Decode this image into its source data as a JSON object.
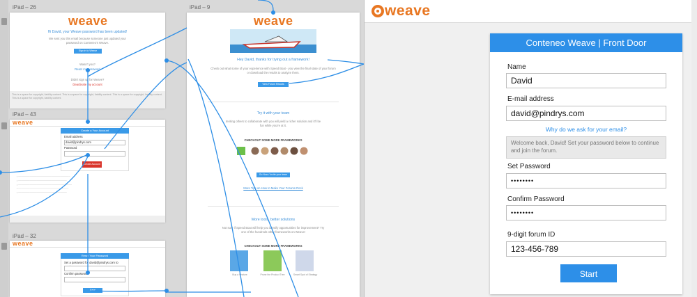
{
  "canvas": {
    "boards": [
      {
        "label": "iPad – 26"
      },
      {
        "label": "iPad – 9"
      },
      {
        "label": "iPad – 43"
      },
      {
        "label": "iPad – 32"
      }
    ],
    "board26": {
      "logo": "weave",
      "heading": "Hi David, your Weave password has been updated!",
      "body": "We sent you this email because someone just updated your password on Conteneo's Weave.",
      "button": "Sign in to Weave",
      "wasnt_you": "Wasn't you?",
      "reset": "Reset my password",
      "didnt_sign": "Didn't sign up for Weave?",
      "deactivate": "Deactivate my account",
      "footer": "This is a space for copyright, liability content. This is a space for copyright, liability content. This is a space for copyright, liability content. This is a space for copyright, liability content."
    },
    "board9": {
      "logo": "weave",
      "heading": "Hey David, thanks for trying out a framework!",
      "body": "Check out what some of your experience with Speed Boat - you view the final state of your forum or download the results to analyze them.",
      "button": "View Forum Results",
      "try_heading": "Try it with your team",
      "try_body": "Inviting others to collaborate with you will yield a richer solution and it'll be fun while you're at it.",
      "checkout": "CHECKOUT SOME MORE FRAMEWORKS",
      "invite_button": "Go Now / Invite your team",
      "tips": "More Tips on How to Make Your Forums Rock",
      "more_heading": "More tools, better solutions",
      "more_body": "Not sure if Speed Boat will help you identify opportunities for improvement? Try one of the hundreds other frameworks on Weave!",
      "checkout2": "CHECKOUT SOME MORE FRAMEWORKS",
      "fw1": "Buy a Feature",
      "fw2": "Prune the Product Tree",
      "fw3": "Smart Spot of Strategy"
    },
    "board43": {
      "logo": "weave",
      "header": "Create a Your Account",
      "email_label": "Email address",
      "email_value": "david@pindrys.com",
      "password_label": "Password",
      "button": "Create Account"
    },
    "board32": {
      "logo": "weave",
      "header": "Reset Your Password",
      "body": "Set a password for david@pindrys.com to continue",
      "confirm_label": "Confirm password",
      "button": "Save"
    }
  },
  "panel": {
    "logo": "weave",
    "card": {
      "title": "Conteneo Weave | Front Door",
      "name_label": "Name",
      "name_value": "David",
      "email_label": "E-mail address",
      "email_value": "david@pindrys.com",
      "why_link": "Why do we ask for your email?",
      "notice": "Welcome back, David! Set your password below to continue and join the forum.",
      "set_password_label": "Set Password",
      "set_password_value": "••••••••",
      "confirm_password_label": "Confirm Password",
      "confirm_password_value": "••••••••",
      "forum_id_label": "9-digit forum ID",
      "forum_id_value": "123-456-789",
      "start_button": "Start"
    }
  },
  "colors": {
    "accent": "#2d8fe8",
    "brand": "#e87722"
  }
}
